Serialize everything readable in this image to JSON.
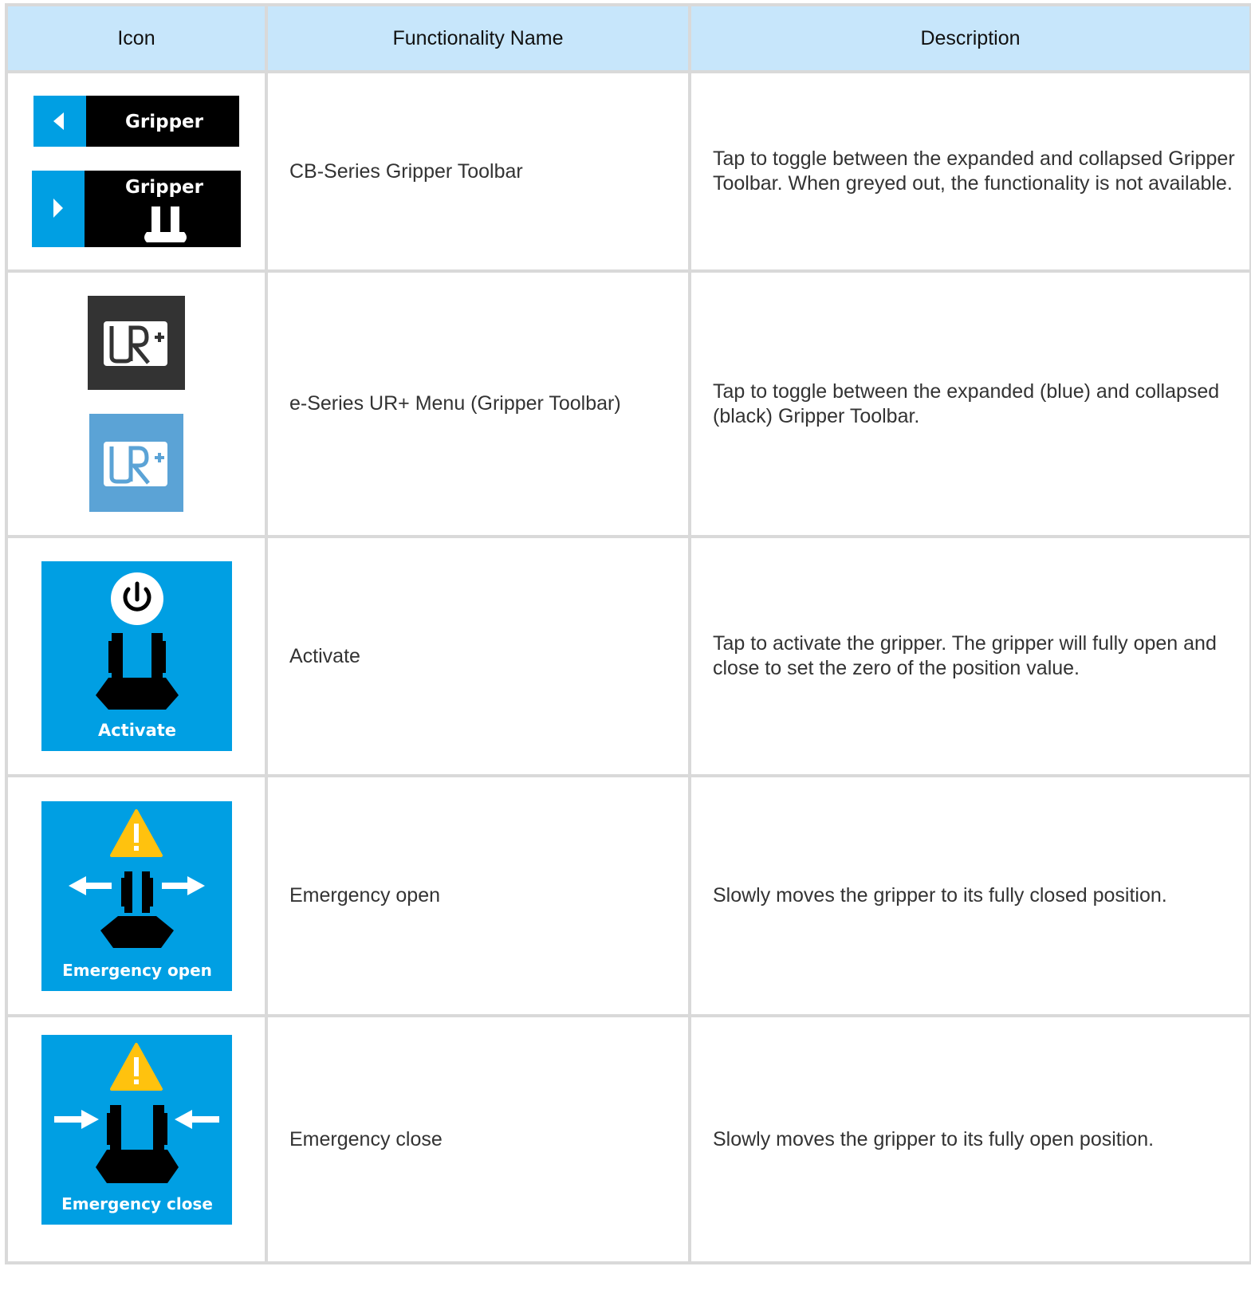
{
  "header": {
    "icon": "Icon",
    "name": "Functionality Name",
    "description": "Description"
  },
  "rows": [
    {
      "name": "CB-Series Gripper Toolbar",
      "description": "Tap to toggle between the expanded and collapsed Gripper Toolbar. When greyed out, the functionality is not available.",
      "icon_labels": [
        "Gripper",
        "Gripper"
      ],
      "icons": [
        "chevron-left-icon",
        "chevron-right-icon",
        "gripper-icon"
      ]
    },
    {
      "name": "e-Series UR+ Menu (Gripper Toolbar)",
      "description": "Tap to toggle between the expanded (blue) and collapsed (black) Gripper Toolbar.",
      "icons": [
        "ur-plus-logo-dark",
        "ur-plus-logo-blue"
      ]
    },
    {
      "name": "Activate",
      "description": "Tap to activate the gripper. The gripper will fully open and close to set the zero of the position value.",
      "icon_label": "Activate",
      "icons": [
        "power-icon",
        "gripper-icon"
      ]
    },
    {
      "name": "Emergency open",
      "description": "Slowly moves the gripper to its fully closed position.",
      "icon_label": "Emergency open",
      "icons": [
        "warning-icon",
        "arrows-outward-icon",
        "gripper-icon"
      ]
    },
    {
      "name": "Emergency close",
      "description": "Slowly moves the gripper to its fully open position.",
      "icon_label": "Emergency close",
      "icons": [
        "warning-icon",
        "arrows-inward-icon",
        "gripper-icon"
      ]
    }
  ],
  "colors": {
    "header_bg": "#c7e6fb",
    "border": "#d9d9d9",
    "icon_blue": "#009fe3",
    "ur_dark": "#333333",
    "ur_blue": "#5ba3d6",
    "warning_yellow": "#ffc20e"
  }
}
